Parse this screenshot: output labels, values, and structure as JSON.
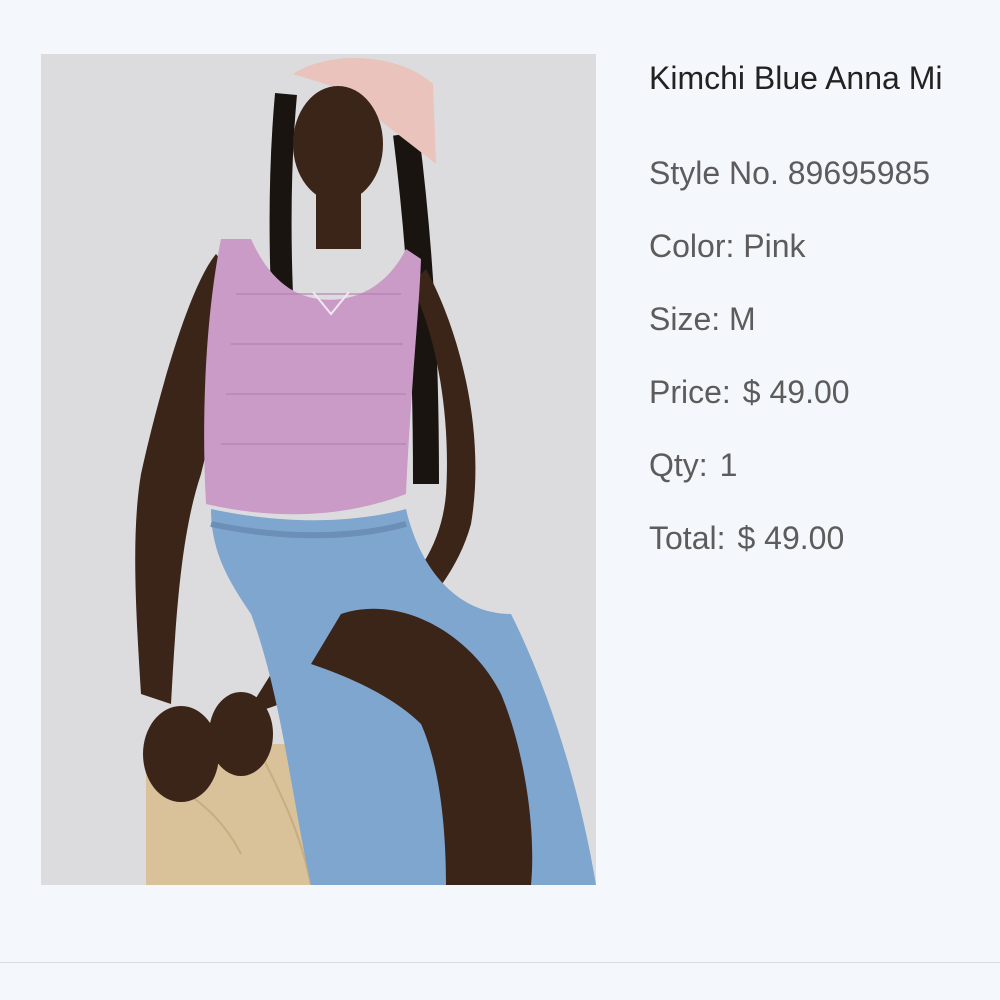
{
  "product": {
    "title": "Kimchi Blue Anna Mi",
    "image_alt": "Model wearing pink top and blue denim skirt"
  },
  "details": {
    "style": "Style No. 89695985",
    "color": "Color: Pink",
    "size": "Size: M",
    "price_label": "Price:",
    "price_value": "$ 49.00",
    "qty_label": "Qty:",
    "qty_value": "1",
    "total_label": "Total:",
    "total_value": "$ 49.00"
  },
  "colors": {
    "background": "#f4f7fb",
    "title_text": "#222222",
    "detail_text": "#5c5c5c",
    "top_pink": "#c99bc6",
    "denim_blue": "#7fa6cf"
  }
}
